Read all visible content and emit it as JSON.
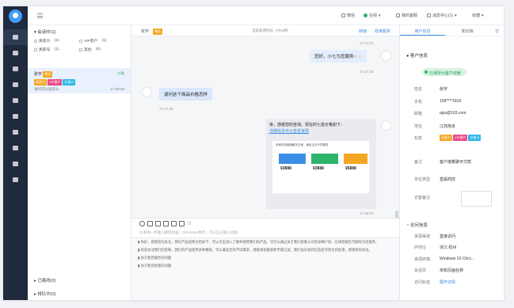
{
  "colors": {
    "accent": "#3a8ee6",
    "nav_bg": "#1f2a3c",
    "online": "#2db36a"
  },
  "topbar": {
    "item1": "微信",
    "status": "在线",
    "item3": "我的客服",
    "item4": "消息中心(1)",
    "user": "张珊"
  },
  "session": {
    "header": "会话中(1)",
    "filters": [
      {
        "label": "离意力",
        "count": "(1)"
      },
      {
        "label": "VIP客户",
        "count": "(1)"
      },
      {
        "label": "离职号",
        "count": "(1)"
      },
      {
        "label": "其他",
        "count": "(0)"
      }
    ],
    "item": {
      "name": "张宇",
      "badge": "微信",
      "status": "AI助",
      "tags": [
        "高意力",
        "VIP客户",
        "交换计"
      ],
      "preview": "请问可以退货么",
      "time": "17:28:23"
    },
    "footer1": "已离线(0)",
    "footer2": "排队中(0)"
  },
  "chat": {
    "header_name": "张宇",
    "header_badge": "微信",
    "header_center": "当前会话时长: 7分19秒",
    "header_action1": "转接",
    "header_action2": "结束服务",
    "t1": "17:27:21",
    "greeting": "您好，小七为您服务~",
    "t2": "17:27:35",
    "question": "请问这个商品价格怎样",
    "t3": "17:27:45",
    "reply_line1": "亲，感谢您的咨询。现在的七急价格如下：",
    "reply_link": "详细信息可以查看官网",
    "card_title": "多种在线客服解决方案，满足企业不同需求",
    "card_prices": [
      "¥3888",
      "¥3888",
      "¥5888"
    ],
    "t4": "17:28:04",
    "input_placeholder": "沙发进一步输入聊到发送，Ctrl+Enter换行，可以自己输入问题",
    "quick_replies": [
      "你好，感谢您的关注，我们产品说明文档如下，可以点击进入了解并使用我们的产品。也可以通过关于我们查看公司的详细介绍，在线客服仍可随时为您服务。",
      "欢迎关注我们的官网，我们的产品提供多种模板，可以满足您的不同需求，请联系客服获取专属方案，我们会在收到信息后尽快为您处理，感谢您的关注。",
      "关于售后服务的问题",
      "关于售后处理的问题"
    ]
  },
  "panel": {
    "tabs": [
      "用户信息",
      "知识库",
      "订"
    ],
    "customer_header": "客户信息",
    "saved": "已保存为客户线索",
    "fields": [
      {
        "label": "姓名",
        "value": "张宇"
      },
      {
        "label": "手机",
        "value": "158****1815"
      },
      {
        "label": "邮箱",
        "value": "qiyu@163.com"
      },
      {
        "label": "地址",
        "value": "江苏南京"
      }
    ],
    "tags_label": "标签",
    "tags": [
      "高意力",
      "VIP客户",
      "交换计"
    ],
    "remark_label": "备注",
    "remark_value": "客户接着聊天付款",
    "unit_label": "单位类型",
    "unit_value": "直属商控",
    "visit_remark_label": "访客备注",
    "visit_header": "访问信息",
    "visit": [
      {
        "label": "来源渠道",
        "value": "直接访问"
      },
      {
        "label": "IP地址",
        "value": "浙江 杭州"
      },
      {
        "label": "来源终端",
        "value": "Windows 10·Chro..."
      },
      {
        "label": "会话页",
        "value": "未知页面名称"
      },
      {
        "label": "访问轨迹",
        "value": "展开详情"
      }
    ]
  }
}
